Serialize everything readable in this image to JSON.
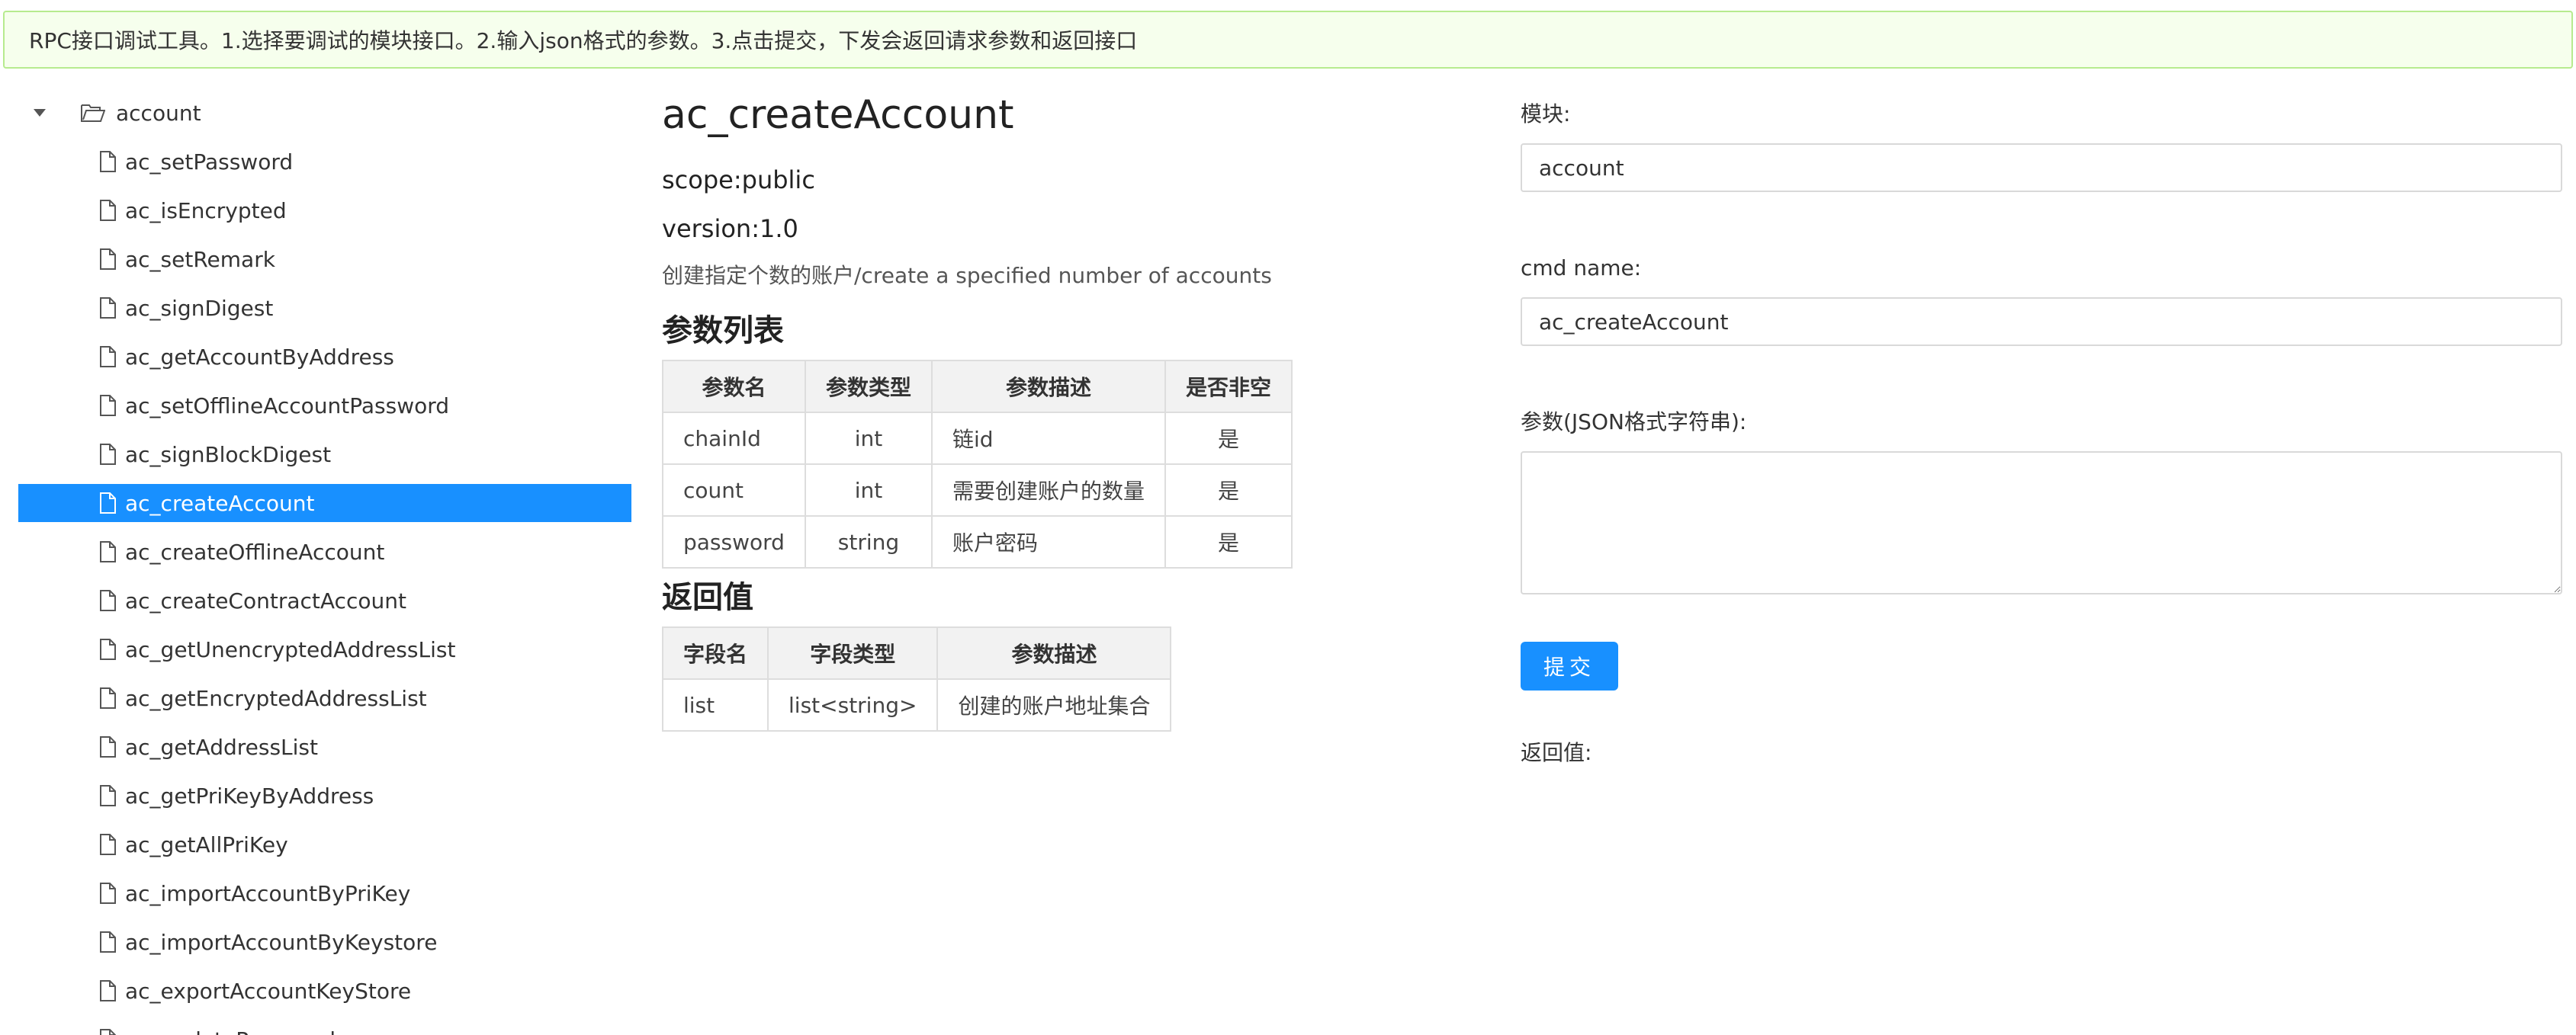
{
  "banner": {
    "text": "RPC接口调试工具。1.选择要调试的模块接口。2.输入json格式的参数。3.点击提交，下发会返回请求参数和返回接口"
  },
  "tree": {
    "root_label": "account",
    "items": [
      {
        "label": "ac_setPassword"
      },
      {
        "label": "ac_isEncrypted"
      },
      {
        "label": "ac_setRemark"
      },
      {
        "label": "ac_signDigest"
      },
      {
        "label": "ac_getAccountByAddress"
      },
      {
        "label": "ac_setOfflineAccountPassword"
      },
      {
        "label": "ac_signBlockDigest"
      },
      {
        "label": "ac_createAccount",
        "selected": true
      },
      {
        "label": "ac_createOfflineAccount"
      },
      {
        "label": "ac_createContractAccount"
      },
      {
        "label": "ac_getUnencryptedAddressList"
      },
      {
        "label": "ac_getEncryptedAddressList"
      },
      {
        "label": "ac_getAddressList"
      },
      {
        "label": "ac_getPriKeyByAddress"
      },
      {
        "label": "ac_getAllPriKey"
      },
      {
        "label": "ac_importAccountByPriKey"
      },
      {
        "label": "ac_importAccountByKeystore"
      },
      {
        "label": "ac_exportAccountKeyStore"
      },
      {
        "label": "ac_updatePassword"
      }
    ]
  },
  "doc": {
    "title": "ac_createAccount",
    "scope": "scope:public",
    "version": "version:1.0",
    "description": "创建指定个数的账户/create a specified number of accounts",
    "params_heading": "参数列表",
    "params_headers": [
      "参数名",
      "参数类型",
      "参数描述",
      "是否非空"
    ],
    "params_rows": [
      [
        "chainId",
        "int",
        "链id",
        "是"
      ],
      [
        "count",
        "int",
        "需要创建账户的数量",
        "是"
      ],
      [
        "password",
        "string",
        "账户密码",
        "是"
      ]
    ],
    "returns_heading": "返回值",
    "returns_headers": [
      "字段名",
      "字段类型",
      "参数描述"
    ],
    "returns_rows": [
      [
        "list",
        "list<string>",
        "创建的账户地址集合"
      ]
    ]
  },
  "form": {
    "module_label": "模块:",
    "module_value": "account",
    "cmd_label": "cmd name:",
    "cmd_value": "ac_createAccount",
    "params_label": "参数(JSON格式字符串):",
    "params_value": "",
    "submit_label": "提交",
    "return_label": "返回值:"
  },
  "colors": {
    "accent": "#1890ff",
    "banner_bg": "#f6ffed",
    "banner_border": "#b7eb8f"
  }
}
